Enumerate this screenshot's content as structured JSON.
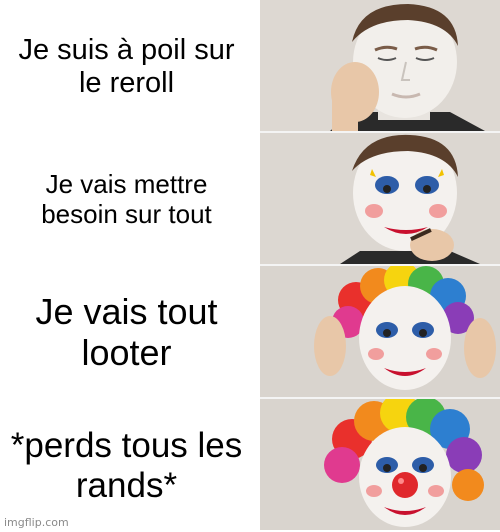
{
  "panels": [
    {
      "caption": "Je suis à poil sur le reroll"
    },
    {
      "caption": "Je vais mettre besoin sur tout"
    },
    {
      "caption": "Je vais tout looter"
    },
    {
      "caption": "*perds tous les rands*"
    }
  ],
  "watermark": "imgflip.com",
  "colors": {
    "background": "#ffffff",
    "text": "#000000",
    "face_paint": "#f4f1ee",
    "nose_red": "#e0282c",
    "lips_red": "#c8102e",
    "eye_blue": "#2d5da8"
  },
  "icons": {
    "panel_1": "clown-applying-white-base-image",
    "panel_2": "clown-applying-eye-and-lip-makeup-image",
    "panel_3": "clown-putting-on-rainbow-wig-image",
    "panel_4": "clown-full-costume-red-nose-image"
  }
}
